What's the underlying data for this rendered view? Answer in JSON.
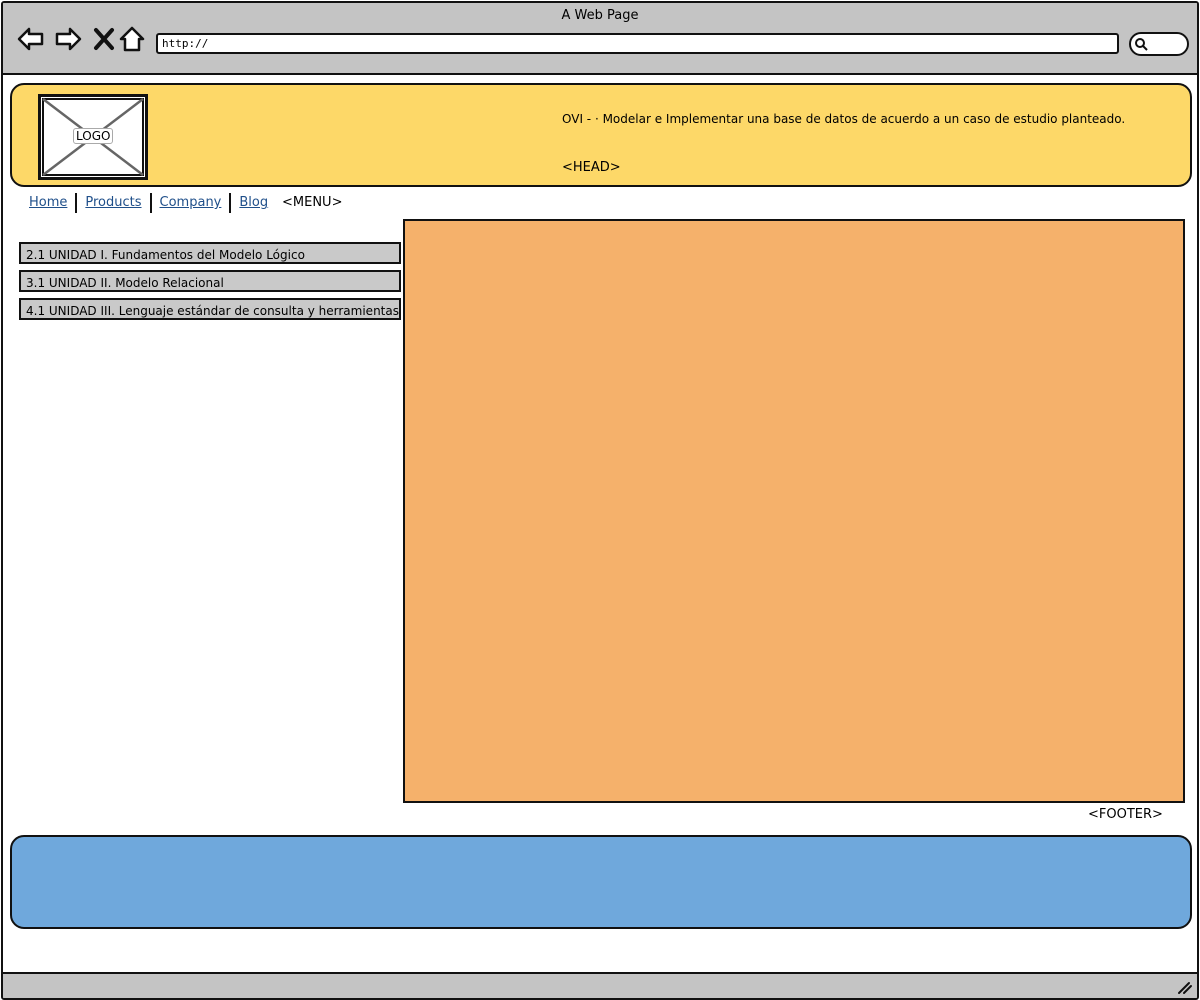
{
  "browser": {
    "title": "A Web Page",
    "url": "http://",
    "nav_icons": [
      "back-arrow-icon",
      "forward-arrow-icon",
      "close-icon",
      "home-icon"
    ],
    "search_icon": "search-icon"
  },
  "header": {
    "logo_label": "LOGO",
    "text": "OVI - ·  Modelar e Implementar una base de datos de acuerdo a un caso de estudio planteado.",
    "tag": "<HEAD>"
  },
  "menu": {
    "items": [
      "Home",
      "Products",
      "Company",
      "Blog"
    ],
    "tag": "<MENU>"
  },
  "sidebar": {
    "items": [
      "2.1 UNIDAD I. Fundamentos del Modelo Lógico",
      "3.1 UNIDAD II. Modelo Relacional",
      "4.1 UNIDAD III. Lenguaje estándar de consulta y herramientas:"
    ]
  },
  "footer": {
    "tag": "<FOOTER>"
  },
  "colors": {
    "chrome": "#c4c4c4",
    "header": "#fdd868",
    "content": "#f5b16b",
    "footer": "#6fa8dc",
    "link": "#1f4f8a"
  }
}
